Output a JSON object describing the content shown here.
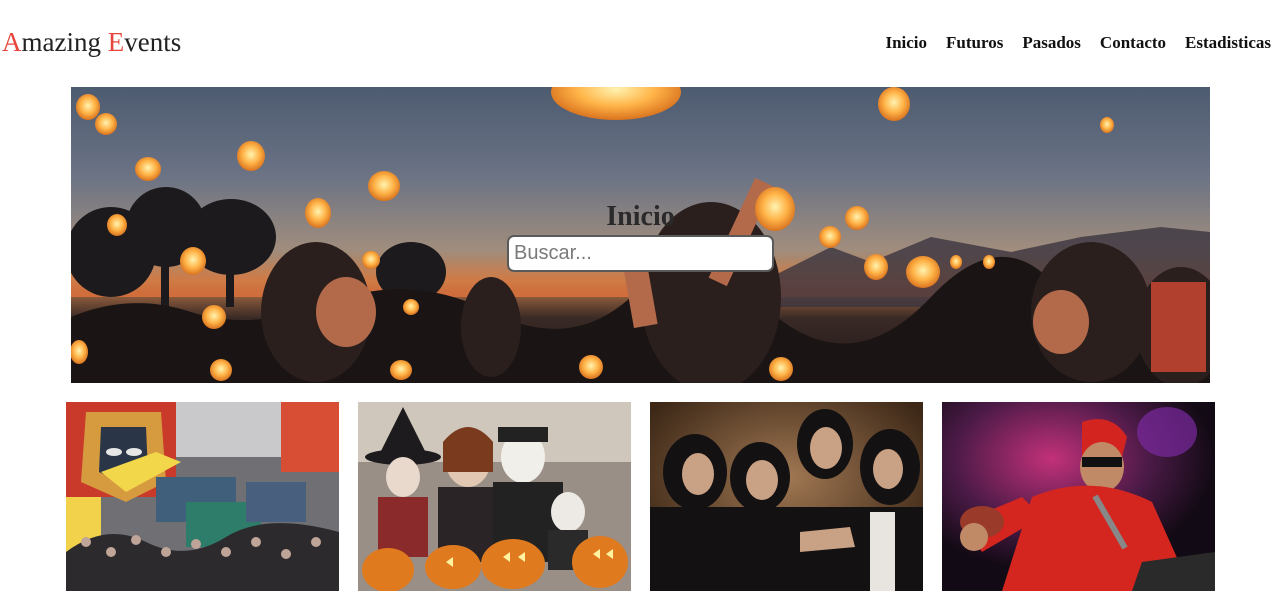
{
  "brand": {
    "first_initial": "A",
    "first_rest": "mazing ",
    "second_initial": "E",
    "second_rest": "vents",
    "accent_color": "#e8453c"
  },
  "nav": {
    "items": [
      "Inicio",
      "Futuros",
      "Pasados",
      "Contacto",
      "Estadisticas"
    ]
  },
  "hero": {
    "title": "Inicio",
    "search_placeholder": "Buscar...",
    "search_value": ""
  },
  "cards": [
    {
      "image": "comic-convention-photo"
    },
    {
      "image": "halloween-family-photo"
    },
    {
      "image": "metal-band-photo"
    },
    {
      "image": "rock-concert-photo"
    }
  ]
}
